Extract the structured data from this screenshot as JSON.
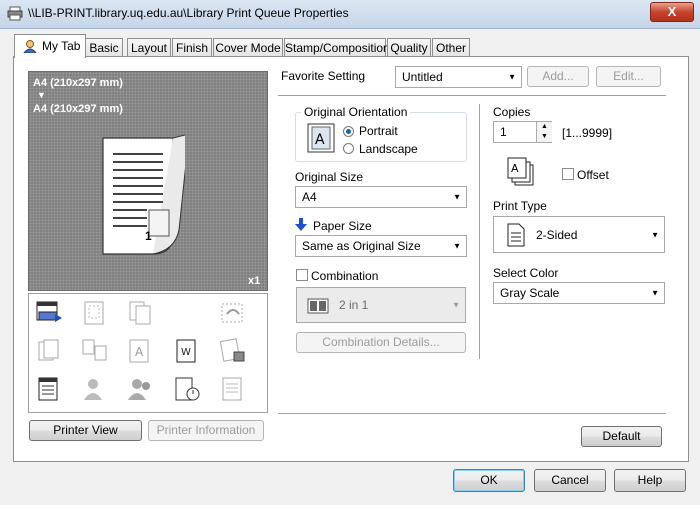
{
  "window": {
    "title": "\\\\LIB-PRINT.library.uq.edu.au\\Library Print Queue Properties",
    "close": "X"
  },
  "tabs": [
    {
      "label": "My Tab"
    },
    {
      "label": "Basic"
    },
    {
      "label": "Layout"
    },
    {
      "label": "Finish"
    },
    {
      "label": "Cover Mode"
    },
    {
      "label": "Stamp/Composition"
    },
    {
      "label": "Quality"
    },
    {
      "label": "Other"
    }
  ],
  "preview": {
    "size_line1": "A4 (210x297 mm)",
    "arrow": "▼",
    "size_line2": "A4 (210x297 mm)",
    "copies_badge": "x1",
    "page_number": "1"
  },
  "left_buttons": {
    "printer_view": "Printer View",
    "printer_information": "Printer Information"
  },
  "favorite": {
    "label": "Favorite Setting",
    "value": "Untitled",
    "add": "Add...",
    "edit": "Edit..."
  },
  "orientation": {
    "label": "Original Orientation",
    "portrait": "Portrait",
    "landscape": "Landscape",
    "selected": "Portrait"
  },
  "original_size": {
    "label": "Original Size",
    "value": "A4"
  },
  "paper_size": {
    "label": "Paper Size",
    "value": "Same as Original Size"
  },
  "combination": {
    "label": "Combination",
    "value": "2 in 1",
    "details": "Combination Details...",
    "checked": false
  },
  "copies": {
    "label": "Copies",
    "value": "1",
    "range": "[1...9999]"
  },
  "offset": {
    "label": "Offset",
    "checked": false
  },
  "print_type": {
    "label": "Print Type",
    "value": "2-Sided"
  },
  "color": {
    "label": "Select Color",
    "value": "Gray Scale"
  },
  "default_button": "Default",
  "footer": {
    "ok": "OK",
    "cancel": "Cancel",
    "help": "Help"
  }
}
